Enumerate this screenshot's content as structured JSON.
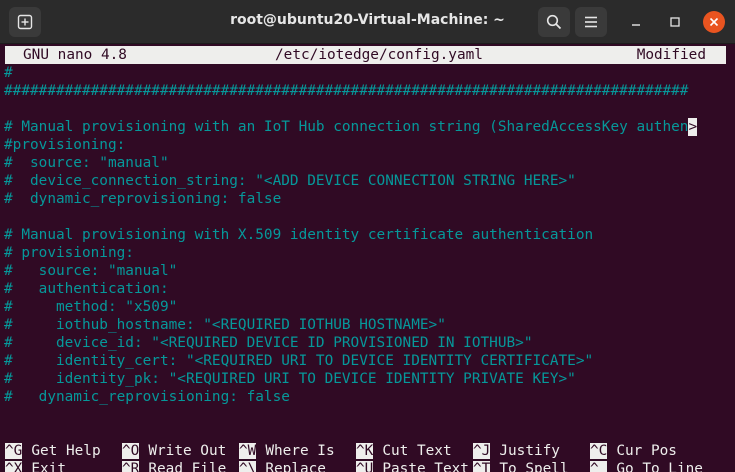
{
  "window": {
    "title": "root@ubuntu20-Virtual-Machine: ~"
  },
  "colors": {
    "terminal_bg": "#300a24",
    "comment_text": "#06989a",
    "header_bg": "#eeeeec",
    "close_button": "#e95420"
  },
  "icons": {
    "new_tab": "new-tab-icon",
    "search": "search-icon",
    "menu": "hamburger-menu-icon",
    "minimize": "minimize-icon",
    "maximize": "maximize-icon",
    "close": "close-icon"
  },
  "nano": {
    "version": "GNU nano 4.8",
    "filename": "/etc/iotedge/config.yaml",
    "status": "Modified",
    "overflow_marker": ">"
  },
  "lines": [
    "#",
    "###############################################################################",
    "",
    "# Manual provisioning with an IoT Hub connection string (SharedAccessKey authen",
    "#provisioning:",
    "#  source: \"manual\"",
    "#  device_connection_string: \"<ADD DEVICE CONNECTION STRING HERE>\"",
    "#  dynamic_reprovisioning: false",
    "",
    "# Manual provisioning with X.509 identity certificate authentication",
    "# provisioning:",
    "#   source: \"manual\"",
    "#   authentication:",
    "#     method: \"x509\"",
    "#     iothub_hostname: \"<REQUIRED IOTHUB HOSTNAME>\"",
    "#     device_id: \"<REQUIRED DEVICE ID PROVISIONED IN IOTHUB>\"",
    "#     identity_cert: \"<REQUIRED URI TO DEVICE IDENTITY CERTIFICATE>\"",
    "#     identity_pk: \"<REQUIRED URI TO DEVICE IDENTITY PRIVATE KEY>\"",
    "#   dynamic_reprovisioning: false"
  ],
  "shortcuts_row1": [
    {
      "key": "^G",
      "label": "Get Help"
    },
    {
      "key": "^O",
      "label": "Write Out"
    },
    {
      "key": "^W",
      "label": "Where Is"
    },
    {
      "key": "^K",
      "label": "Cut Text"
    },
    {
      "key": "^J",
      "label": "Justify"
    },
    {
      "key": "^C",
      "label": "Cur Pos"
    }
  ],
  "shortcuts_row2": [
    {
      "key": "^X",
      "label": "Exit"
    },
    {
      "key": "^R",
      "label": "Read File"
    },
    {
      "key": "^\\",
      "label": "Replace"
    },
    {
      "key": "^U",
      "label": "Paste Text"
    },
    {
      "key": "^T",
      "label": "To Spell"
    },
    {
      "key": "^_",
      "label": "Go To Line"
    }
  ]
}
